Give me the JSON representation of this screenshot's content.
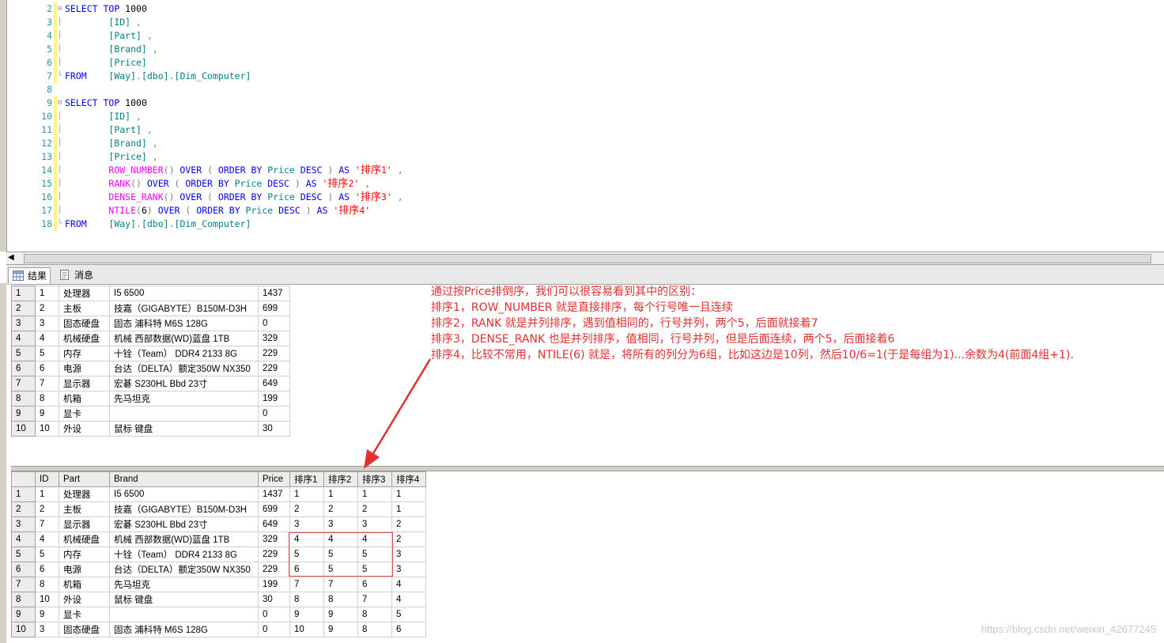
{
  "editor": {
    "lines": [
      {
        "n": "2",
        "fold": "⊟",
        "marker": true,
        "tokens": [
          [
            "kw",
            "SELECT "
          ],
          [
            "kw",
            "TOP "
          ],
          [
            "pl",
            "1000"
          ]
        ]
      },
      {
        "n": "3",
        "fold": "│",
        "marker": true,
        "tokens": [
          [
            "pl",
            "        "
          ],
          [
            "id",
            "[ID]"
          ],
          [
            "gr",
            " ,"
          ]
        ]
      },
      {
        "n": "4",
        "fold": "│",
        "marker": true,
        "tokens": [
          [
            "pl",
            "        "
          ],
          [
            "id",
            "[Part]"
          ],
          [
            "gr",
            " ,"
          ]
        ]
      },
      {
        "n": "5",
        "fold": "│",
        "marker": true,
        "tokens": [
          [
            "pl",
            "        "
          ],
          [
            "id",
            "[Brand]"
          ],
          [
            "gr",
            " ,"
          ]
        ]
      },
      {
        "n": "6",
        "fold": "│",
        "marker": true,
        "tokens": [
          [
            "pl",
            "        "
          ],
          [
            "id",
            "[Price]"
          ]
        ]
      },
      {
        "n": "7",
        "fold": "└",
        "marker": true,
        "tokens": [
          [
            "kw",
            "FROM    "
          ],
          [
            "id",
            "[Way]"
          ],
          [
            "gr",
            "."
          ],
          [
            "id",
            "[dbo]"
          ],
          [
            "gr",
            "."
          ],
          [
            "id",
            "[Dim_Computer]"
          ]
        ]
      },
      {
        "n": "8",
        "fold": "",
        "marker": false,
        "tokens": []
      },
      {
        "n": "9",
        "fold": "⊟",
        "marker": true,
        "tokens": [
          [
            "kw",
            "SELECT "
          ],
          [
            "kw",
            "TOP "
          ],
          [
            "pl",
            "1000"
          ]
        ]
      },
      {
        "n": "10",
        "fold": "│",
        "marker": true,
        "tokens": [
          [
            "pl",
            "        "
          ],
          [
            "id",
            "[ID]"
          ],
          [
            "gr",
            " ,"
          ]
        ]
      },
      {
        "n": "11",
        "fold": "│",
        "marker": true,
        "tokens": [
          [
            "pl",
            "        "
          ],
          [
            "id",
            "[Part]"
          ],
          [
            "gr",
            " ,"
          ]
        ]
      },
      {
        "n": "12",
        "fold": "│",
        "marker": true,
        "tokens": [
          [
            "pl",
            "        "
          ],
          [
            "id",
            "[Brand]"
          ],
          [
            "gr",
            " ,"
          ]
        ]
      },
      {
        "n": "13",
        "fold": "│",
        "marker": true,
        "tokens": [
          [
            "pl",
            "        "
          ],
          [
            "id",
            "[Price]"
          ],
          [
            "gr",
            " ,"
          ]
        ]
      },
      {
        "n": "14",
        "fold": "│",
        "marker": true,
        "tokens": [
          [
            "pl",
            "        "
          ],
          [
            "fn",
            "ROW_NUMBER"
          ],
          [
            "gr",
            "() "
          ],
          [
            "kw",
            "OVER "
          ],
          [
            "gr",
            "( "
          ],
          [
            "kw",
            "ORDER BY "
          ],
          [
            "id",
            "Price "
          ],
          [
            "kw",
            "DESC "
          ],
          [
            "gr",
            ") "
          ],
          [
            "kw",
            "AS "
          ],
          [
            "str",
            "'"
          ],
          [
            "strc",
            "排序"
          ],
          [
            "str",
            "1'"
          ],
          [
            "gr",
            " ,"
          ]
        ]
      },
      {
        "n": "15",
        "fold": "│",
        "marker": true,
        "tokens": [
          [
            "pl",
            "        "
          ],
          [
            "fn",
            "RANK"
          ],
          [
            "gr",
            "() "
          ],
          [
            "kw",
            "OVER "
          ],
          [
            "gr",
            "( "
          ],
          [
            "kw",
            "ORDER BY "
          ],
          [
            "id",
            "Price "
          ],
          [
            "kw",
            "DESC "
          ],
          [
            "gr",
            ") "
          ],
          [
            "kw",
            "AS "
          ],
          [
            "str",
            "'"
          ],
          [
            "strc",
            "排序"
          ],
          [
            "str",
            "2'"
          ],
          [
            "gr",
            " ,"
          ]
        ]
      },
      {
        "n": "16",
        "fold": "│",
        "marker": true,
        "tokens": [
          [
            "pl",
            "        "
          ],
          [
            "fn",
            "DENSE_RANK"
          ],
          [
            "gr",
            "() "
          ],
          [
            "kw",
            "OVER "
          ],
          [
            "gr",
            "( "
          ],
          [
            "kw",
            "ORDER BY "
          ],
          [
            "id",
            "Price "
          ],
          [
            "kw",
            "DESC "
          ],
          [
            "gr",
            ") "
          ],
          [
            "kw",
            "AS "
          ],
          [
            "str",
            "'"
          ],
          [
            "strc",
            "排序"
          ],
          [
            "str",
            "3'"
          ],
          [
            "gr",
            " ,"
          ]
        ]
      },
      {
        "n": "17",
        "fold": "│",
        "marker": true,
        "tokens": [
          [
            "pl",
            "        "
          ],
          [
            "fn",
            "NTILE"
          ],
          [
            "gr",
            "("
          ],
          [
            "pl",
            "6"
          ],
          [
            "gr",
            ") "
          ],
          [
            "kw",
            "OVER "
          ],
          [
            "gr",
            "( "
          ],
          [
            "kw",
            "ORDER BY "
          ],
          [
            "id",
            "Price "
          ],
          [
            "kw",
            "DESC "
          ],
          [
            "gr",
            ") "
          ],
          [
            "kw",
            "AS "
          ],
          [
            "str",
            "'"
          ],
          [
            "strc",
            "排序"
          ],
          [
            "str",
            "4'"
          ]
        ]
      },
      {
        "n": "18",
        "fold": "└",
        "marker": true,
        "tokens": [
          [
            "kw",
            "FROM    "
          ],
          [
            "id",
            "[Way]"
          ],
          [
            "gr",
            "."
          ],
          [
            "id",
            "[dbo]"
          ],
          [
            "gr",
            "."
          ],
          [
            "id",
            "[Dim_Computer]"
          ]
        ]
      }
    ]
  },
  "tabs": [
    {
      "label": "结果",
      "icon": "grid-icon",
      "active": true
    },
    {
      "label": "消息",
      "icon": "message-icon",
      "active": false
    }
  ],
  "grid1": {
    "rows": [
      [
        "1",
        "1",
        "处理器",
        "I5 6500",
        "1437"
      ],
      [
        "2",
        "2",
        "主板",
        "技嘉（GIGABYTE）B150M-D3H",
        "699"
      ],
      [
        "3",
        "3",
        "固态硬盘",
        "固态 浦科特 M6S 128G",
        "0"
      ],
      [
        "4",
        "4",
        "机械硬盘",
        "机械 西部数据(WD)蓝盘 1TB",
        "329"
      ],
      [
        "5",
        "5",
        "内存",
        "十铨（Team） DDR4 2133 8G",
        "229"
      ],
      [
        "6",
        "6",
        "电源",
        "台达（DELTA）额定350W NX350",
        "229"
      ],
      [
        "7",
        "7",
        "显示器",
        "宏碁 S230HL Bbd 23寸",
        "649"
      ],
      [
        "8",
        "8",
        "机箱",
        "先马坦克",
        "199"
      ],
      [
        "9",
        "9",
        "显卡",
        "",
        "0"
      ],
      [
        "10",
        "10",
        "外设",
        "鼠标 键盘",
        "30"
      ]
    ]
  },
  "grid2": {
    "headers": [
      "",
      "ID",
      "Part",
      "Brand",
      "Price",
      "排序1",
      "排序2",
      "排序3",
      "排序4"
    ],
    "rows": [
      [
        "1",
        "1",
        "处理器",
        "I5 6500",
        "1437",
        "1",
        "1",
        "1",
        "1"
      ],
      [
        "2",
        "2",
        "主板",
        "技嘉（GIGABYTE）B150M-D3H",
        "699",
        "2",
        "2",
        "2",
        "1"
      ],
      [
        "3",
        "7",
        "显示器",
        "宏碁 S230HL Bbd 23寸",
        "649",
        "3",
        "3",
        "3",
        "2"
      ],
      [
        "4",
        "4",
        "机械硬盘",
        "机械 西部数据(WD)蓝盘 1TB",
        "329",
        "4",
        "4",
        "4",
        "2"
      ],
      [
        "5",
        "5",
        "内存",
        "十铨（Team） DDR4 2133 8G",
        "229",
        "5",
        "5",
        "5",
        "3"
      ],
      [
        "6",
        "6",
        "电源",
        "台达（DELTA）额定350W NX350",
        "229",
        "6",
        "5",
        "5",
        "3"
      ],
      [
        "7",
        "8",
        "机箱",
        "先马坦克",
        "199",
        "7",
        "7",
        "6",
        "4"
      ],
      [
        "8",
        "10",
        "外设",
        "鼠标 键盘",
        "30",
        "8",
        "8",
        "7",
        "4"
      ],
      [
        "9",
        "9",
        "显卡",
        "",
        "0",
        "9",
        "9",
        "8",
        "5"
      ],
      [
        "10",
        "3",
        "固态硬盘",
        "固态 浦科特 M6S 128G",
        "0",
        "10",
        "9",
        "8",
        "6"
      ]
    ]
  },
  "note": {
    "lines": [
      "通过按Price排倒序，我们可以很容易看到其中的区别：",
      "排序1，ROW_NUMBER 就是直接排序，每个行号唯一且连续",
      "排序2，RANK 就是并列排序，遇到值相同的，行号并列，两个5，后面就接着7",
      "排序3，DENSE_RANK 也是并列排序，值相同，行号并列，但是后面连续，两个5，后面接着6",
      "排序4，比较不常用，NTILE(6) 就是，将所有的列分为6组，比如这边是10列，然后10/6=1(于是每组为1)...余数为4(前面4组+1)."
    ]
  },
  "watermark": "https://blog.csdn.net/weixin_42677245",
  "colors": {
    "annotation": "#e03030",
    "keyword": "#0000ff",
    "identifier": "#008080",
    "function": "#ff00ff",
    "string": "#ff0000"
  }
}
